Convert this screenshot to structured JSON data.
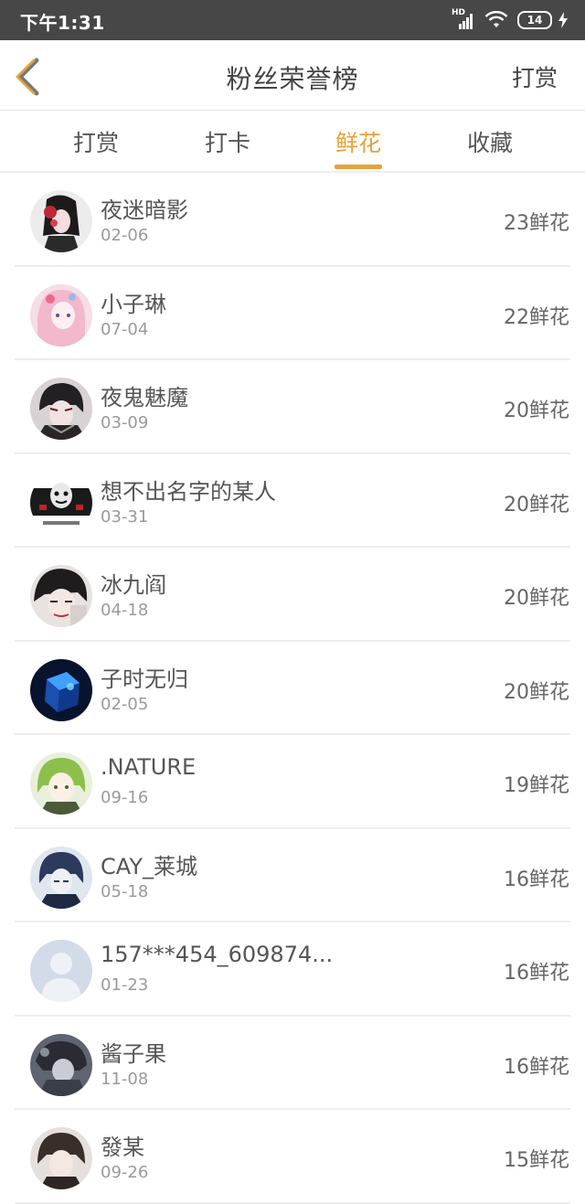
{
  "status_bar": {
    "time": "下午1:31",
    "network": "HD",
    "battery": "14"
  },
  "header": {
    "title": "粉丝荣誉榜",
    "action_label": "打赏"
  },
  "tabs": [
    {
      "label": "打赏",
      "active": false
    },
    {
      "label": "打卡",
      "active": false
    },
    {
      "label": "鲜花",
      "active": true
    },
    {
      "label": "收藏",
      "active": false
    }
  ],
  "colors": {
    "accent": "#e8a13a",
    "status_bar": "#474747"
  },
  "list": [
    {
      "name": "夜迷暗影",
      "date": "02-06",
      "count": "23鲜花",
      "avatar": "anime-girl-red-flower"
    },
    {
      "name": "小子琳",
      "date": "07-04",
      "count": "22鲜花",
      "avatar": "anime-girl-pink"
    },
    {
      "name": "夜鬼魅魔",
      "date": "03-09",
      "count": "20鲜花",
      "avatar": "anime-boy-dark"
    },
    {
      "name": "想不出名字的某人",
      "date": "03-31",
      "count": "20鲜花",
      "avatar": "meme-face"
    },
    {
      "name": "冰九阎",
      "date": "04-18",
      "count": "20鲜花",
      "avatar": "anime-boy-black-hair"
    },
    {
      "name": "子时无归",
      "date": "02-05",
      "count": "20鲜花",
      "avatar": "blue-cube"
    },
    {
      "name": ".NATURE",
      "date": "09-16",
      "count": "19鲜花",
      "avatar": "anime-green-hair"
    },
    {
      "name": "CAY_莱城",
      "date": "05-18",
      "count": "16鲜花",
      "avatar": "anime-boy-blue"
    },
    {
      "name": "157***454_609874...",
      "date": "01-23",
      "count": "16鲜花",
      "avatar": "default-person"
    },
    {
      "name": "酱子果",
      "date": "11-08",
      "count": "16鲜花",
      "avatar": "anime-dark-figure"
    },
    {
      "name": "發某",
      "date": "09-26",
      "count": "15鲜花",
      "avatar": "anime-boy-brown"
    }
  ]
}
